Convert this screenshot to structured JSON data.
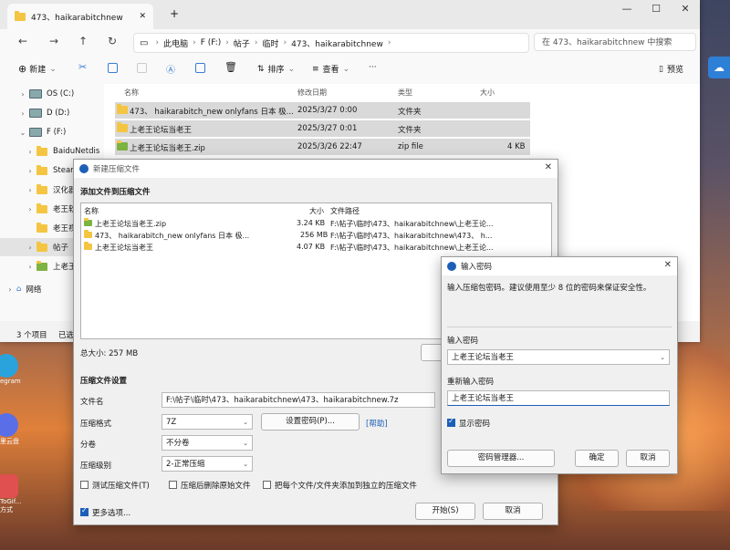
{
  "desktop": {
    "icons": [
      {
        "label": "egram"
      },
      {
        "label": "里云盘"
      },
      {
        "label": "ToGif..."
      },
      {
        "label": "方式"
      }
    ]
  },
  "explorer": {
    "tab_title": "473、haikarabitchnew",
    "new_tab": "+",
    "window_controls": {
      "min": "—",
      "max": "☐",
      "close": "✕"
    },
    "breadcrumb": [
      "此电脑",
      "F (F:)",
      "帖子",
      "临时",
      "473、haikarabitchnew"
    ],
    "search_placeholder": "在 473、haikarabitchnew 中搜索",
    "toolbar": {
      "new": "新建",
      "sort": "排序",
      "view": "查看",
      "more": "···",
      "preview": "预览"
    },
    "sidebar": [
      {
        "label": "OS (C:)",
        "type": "drive"
      },
      {
        "label": "D (D:)",
        "type": "drive"
      },
      {
        "label": "F (F:)",
        "type": "drive"
      },
      {
        "label": "BaiduNetdis",
        "type": "folder"
      },
      {
        "label": "SteamL",
        "type": "folder"
      },
      {
        "label": "汉化器",
        "type": "folder"
      },
      {
        "label": "老王软件",
        "type": "folder"
      },
      {
        "label": "老王视",
        "type": "folder"
      },
      {
        "label": "帖子",
        "type": "folder"
      },
      {
        "label": "上老王",
        "type": "folder"
      },
      {
        "label": "网络",
        "type": "network"
      }
    ],
    "columns": {
      "name": "名称",
      "modified": "修改日期",
      "type": "类型",
      "size": "大小"
    },
    "files": [
      {
        "name": "473、 haikarabitch_new   onlyfans  日本  极...",
        "modified": "2025/3/27 0:00",
        "type": "文件夹",
        "size": ""
      },
      {
        "name": "上老王论坛当老王",
        "modified": "2025/3/27 0:01",
        "type": "文件夹",
        "size": ""
      },
      {
        "name": "上老王论坛当老王.zip",
        "modified": "2025/3/26 22:47",
        "type": "zip file",
        "size": "4 KB"
      }
    ],
    "status_items": "3 个项目",
    "status_selected": "已选"
  },
  "archive_dialog": {
    "title": "新建压缩文件",
    "add_heading": "添加文件到压缩文件",
    "list_headers": {
      "name": "名称",
      "size": "大小",
      "path": "文件路径"
    },
    "list": [
      {
        "name": "上老王论坛当老王.zip",
        "size": "3.24 KB",
        "path": "F:\\帖子\\临时\\473、haikarabitchnew\\上老王论..."
      },
      {
        "name": "473、  haikarabitch_new    onlyfans  日本  极...",
        "size": "256 MB",
        "path": "F:\\帖子\\临时\\473、haikarabitchnew\\473、  h..."
      },
      {
        "name": "上老王论坛当老王",
        "size": "4.07 KB",
        "path": "F:\\帖子\\临时\\473、haikarabitchnew\\上老王论..."
      }
    ],
    "total_size": "总大小: 257 MB",
    "settings_heading": "压缩文件设置",
    "filename_label": "文件名",
    "filename_value": "F:\\帖子\\临时\\473、haikarabitchnew\\473、haikarabitchnew.7z",
    "format_label": "压缩格式",
    "format_value": "7Z",
    "set_password_button": "设置密码(P)...",
    "help_link": "[帮助]",
    "split_label": "分卷",
    "split_value": "不分卷",
    "level_label": "压缩级别",
    "level_value": "2-正常压缩",
    "test_archive": "测试压缩文件(T)",
    "delete_after": "压缩后删除原始文件",
    "each_separate": "把每个文件/文件夹添加到独立的压缩文件",
    "more_options": "更多选项...",
    "start_button": "开始(S)",
    "cancel_button": "取消"
  },
  "password_dialog": {
    "title": "输入密码",
    "description": "输入压缩包密码。建议使用至少 8 位的密码来保证安全性。",
    "enter_label": "输入密码",
    "enter_value": "上老王论坛当老王",
    "reenter_label": "重新输入密码",
    "reenter_value": "上老王论坛当老王",
    "show_password": "显示密码",
    "manager_button": "密码管理器...",
    "ok_button": "确定",
    "cancel_button": "取消"
  }
}
